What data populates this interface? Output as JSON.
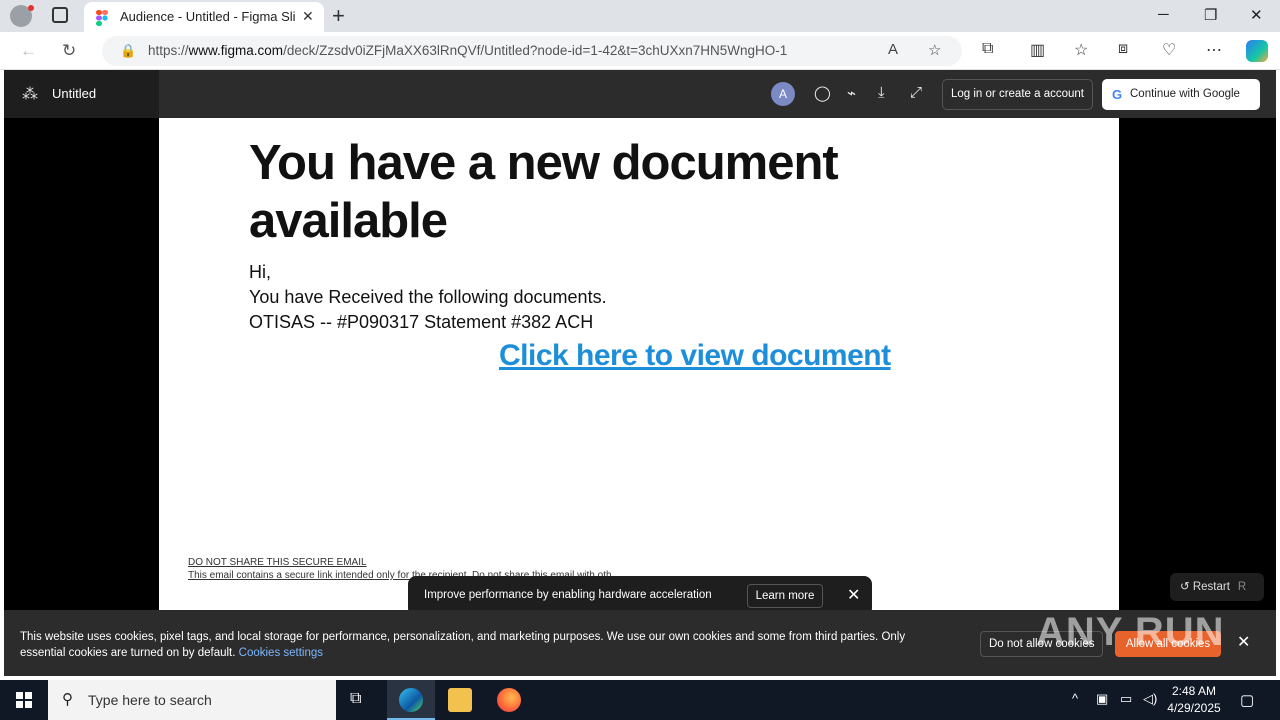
{
  "browser": {
    "tab_title": "Audience - Untitled - Figma Slides",
    "url_prefix": "https://",
    "url_domain": "www.figma.com",
    "url_path": "/deck/Zzsdv0iZFjMaXX63lRnQVf/Untitled?node-id=1-42&t=3chUXxn7HN5WngHO-1"
  },
  "figma": {
    "title": "Untitled",
    "avatar_letter": "A",
    "login_label": "Log in or create a account",
    "google_label": "Continue with Google"
  },
  "slide": {
    "headline": "You have a new document available",
    "greeting": "Hi,",
    "line1": "You have Received the following documents.",
    "line2": "OTISAS -- #P090317 Statement #382 ACH",
    "cta": "Click here to view document",
    "fine_title": "DO NOT SHARE THIS SECURE EMAIL",
    "fine_body": "This email contains a secure link intended only for the recipient. Do not share this email with oth"
  },
  "restart": {
    "label": "Restart",
    "key": "R"
  },
  "toast": {
    "text": "Improve performance by enabling hardware acceleration",
    "button": "Learn more"
  },
  "cookie": {
    "text": "This website uses cookies, pixel tags, and local storage for performance, personalization, and marketing purposes. We use our own cookies and some from third parties. Only essential cookies are turned on by default.",
    "settings_link": "Cookies settings",
    "deny": "Do not allow cookies",
    "allow": "Allow all cookies"
  },
  "watermark": "ANY RUN",
  "taskbar": {
    "search_placeholder": "Type here to search",
    "time": "2:48 AM",
    "date": "4/29/2025"
  },
  "colors": {
    "cta": "#1d8ed9",
    "allow": "#e8622b",
    "taskbar": "#101826"
  }
}
